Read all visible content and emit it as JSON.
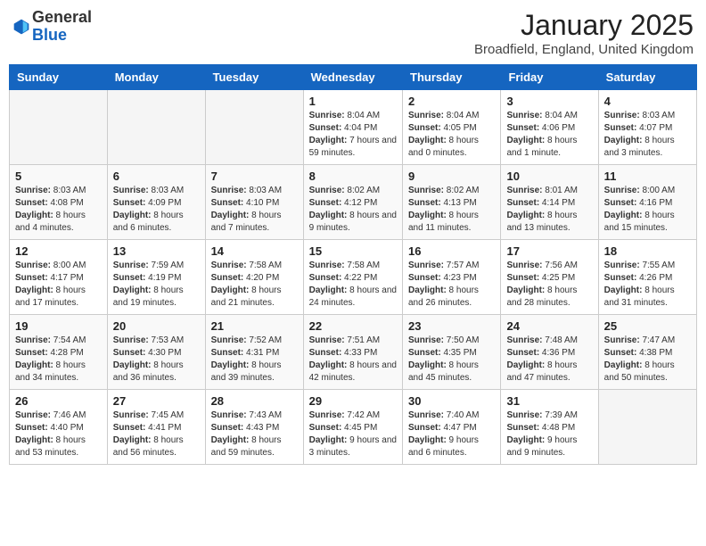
{
  "header": {
    "logo_general": "General",
    "logo_blue": "Blue",
    "month_title": "January 2025",
    "location": "Broadfield, England, United Kingdom"
  },
  "weekdays": [
    "Sunday",
    "Monday",
    "Tuesday",
    "Wednesday",
    "Thursday",
    "Friday",
    "Saturday"
  ],
  "weeks": [
    [
      {
        "day": "",
        "info": ""
      },
      {
        "day": "",
        "info": ""
      },
      {
        "day": "",
        "info": ""
      },
      {
        "day": "1",
        "info": "Sunrise: 8:04 AM\nSunset: 4:04 PM\nDaylight: 7 hours and 59 minutes."
      },
      {
        "day": "2",
        "info": "Sunrise: 8:04 AM\nSunset: 4:05 PM\nDaylight: 8 hours and 0 minutes."
      },
      {
        "day": "3",
        "info": "Sunrise: 8:04 AM\nSunset: 4:06 PM\nDaylight: 8 hours and 1 minute."
      },
      {
        "day": "4",
        "info": "Sunrise: 8:03 AM\nSunset: 4:07 PM\nDaylight: 8 hours and 3 minutes."
      }
    ],
    [
      {
        "day": "5",
        "info": "Sunrise: 8:03 AM\nSunset: 4:08 PM\nDaylight: 8 hours and 4 minutes."
      },
      {
        "day": "6",
        "info": "Sunrise: 8:03 AM\nSunset: 4:09 PM\nDaylight: 8 hours and 6 minutes."
      },
      {
        "day": "7",
        "info": "Sunrise: 8:03 AM\nSunset: 4:10 PM\nDaylight: 8 hours and 7 minutes."
      },
      {
        "day": "8",
        "info": "Sunrise: 8:02 AM\nSunset: 4:12 PM\nDaylight: 8 hours and 9 minutes."
      },
      {
        "day": "9",
        "info": "Sunrise: 8:02 AM\nSunset: 4:13 PM\nDaylight: 8 hours and 11 minutes."
      },
      {
        "day": "10",
        "info": "Sunrise: 8:01 AM\nSunset: 4:14 PM\nDaylight: 8 hours and 13 minutes."
      },
      {
        "day": "11",
        "info": "Sunrise: 8:00 AM\nSunset: 4:16 PM\nDaylight: 8 hours and 15 minutes."
      }
    ],
    [
      {
        "day": "12",
        "info": "Sunrise: 8:00 AM\nSunset: 4:17 PM\nDaylight: 8 hours and 17 minutes."
      },
      {
        "day": "13",
        "info": "Sunrise: 7:59 AM\nSunset: 4:19 PM\nDaylight: 8 hours and 19 minutes."
      },
      {
        "day": "14",
        "info": "Sunrise: 7:58 AM\nSunset: 4:20 PM\nDaylight: 8 hours and 21 minutes."
      },
      {
        "day": "15",
        "info": "Sunrise: 7:58 AM\nSunset: 4:22 PM\nDaylight: 8 hours and 24 minutes."
      },
      {
        "day": "16",
        "info": "Sunrise: 7:57 AM\nSunset: 4:23 PM\nDaylight: 8 hours and 26 minutes."
      },
      {
        "day": "17",
        "info": "Sunrise: 7:56 AM\nSunset: 4:25 PM\nDaylight: 8 hours and 28 minutes."
      },
      {
        "day": "18",
        "info": "Sunrise: 7:55 AM\nSunset: 4:26 PM\nDaylight: 8 hours and 31 minutes."
      }
    ],
    [
      {
        "day": "19",
        "info": "Sunrise: 7:54 AM\nSunset: 4:28 PM\nDaylight: 8 hours and 34 minutes."
      },
      {
        "day": "20",
        "info": "Sunrise: 7:53 AM\nSunset: 4:30 PM\nDaylight: 8 hours and 36 minutes."
      },
      {
        "day": "21",
        "info": "Sunrise: 7:52 AM\nSunset: 4:31 PM\nDaylight: 8 hours and 39 minutes."
      },
      {
        "day": "22",
        "info": "Sunrise: 7:51 AM\nSunset: 4:33 PM\nDaylight: 8 hours and 42 minutes."
      },
      {
        "day": "23",
        "info": "Sunrise: 7:50 AM\nSunset: 4:35 PM\nDaylight: 8 hours and 45 minutes."
      },
      {
        "day": "24",
        "info": "Sunrise: 7:48 AM\nSunset: 4:36 PM\nDaylight: 8 hours and 47 minutes."
      },
      {
        "day": "25",
        "info": "Sunrise: 7:47 AM\nSunset: 4:38 PM\nDaylight: 8 hours and 50 minutes."
      }
    ],
    [
      {
        "day": "26",
        "info": "Sunrise: 7:46 AM\nSunset: 4:40 PM\nDaylight: 8 hours and 53 minutes."
      },
      {
        "day": "27",
        "info": "Sunrise: 7:45 AM\nSunset: 4:41 PM\nDaylight: 8 hours and 56 minutes."
      },
      {
        "day": "28",
        "info": "Sunrise: 7:43 AM\nSunset: 4:43 PM\nDaylight: 8 hours and 59 minutes."
      },
      {
        "day": "29",
        "info": "Sunrise: 7:42 AM\nSunset: 4:45 PM\nDaylight: 9 hours and 3 minutes."
      },
      {
        "day": "30",
        "info": "Sunrise: 7:40 AM\nSunset: 4:47 PM\nDaylight: 9 hours and 6 minutes."
      },
      {
        "day": "31",
        "info": "Sunrise: 7:39 AM\nSunset: 4:48 PM\nDaylight: 9 hours and 9 minutes."
      },
      {
        "day": "",
        "info": ""
      }
    ]
  ]
}
